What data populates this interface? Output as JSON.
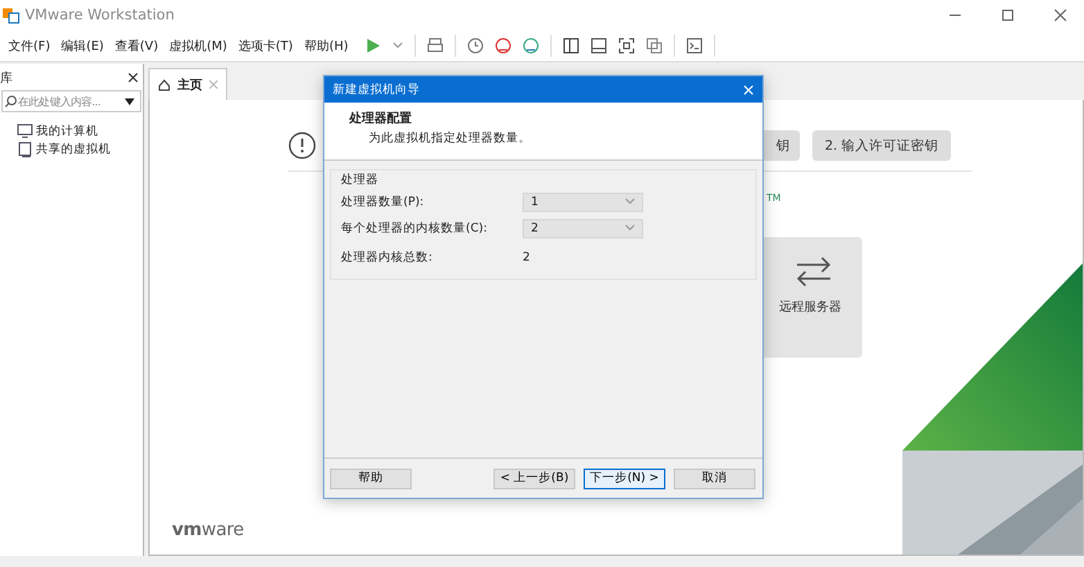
{
  "window": {
    "title": "VMware Workstation"
  },
  "menu": [
    {
      "label": "文件(F)"
    },
    {
      "label": "编辑(E)"
    },
    {
      "label": "查看(V)"
    },
    {
      "label": "虚拟机(M)"
    },
    {
      "label": "选项卡(T)"
    },
    {
      "label": "帮助(H)"
    }
  ],
  "library": {
    "title": "库",
    "search": {
      "placeholder": "在此处键入内容..."
    },
    "tree": [
      {
        "label": "我的计算机",
        "kind": "computer"
      },
      {
        "label": "共享的虚拟机",
        "kind": "shared"
      }
    ]
  },
  "tabs": [
    {
      "label": "主页",
      "selected": true
    }
  ],
  "home": {
    "license_buttons": [
      "钥",
      "2. 输入许可证密钥"
    ],
    "trademark": "TM",
    "remote_card": "远程服务器",
    "logo": "**vm**ware"
  },
  "dialog": {
    "title": "新建虚拟机向导",
    "heading": "处理器配置",
    "subtitle": "为此虚拟机指定处理器数量。",
    "group": "处理器",
    "fields": [
      {
        "label": "处理器数量(P):",
        "kind": "select",
        "value": "1"
      },
      {
        "label": "每个处理器的内核数量(C):",
        "kind": "select",
        "value": "2"
      },
      {
        "label": "处理器内核总数:",
        "kind": "text",
        "value": "2"
      }
    ],
    "buttons": [
      {
        "label": "帮助",
        "default": false
      },
      {
        "label": "< 上一步(B)",
        "default": false
      },
      {
        "label": "下一步(N) >",
        "default": true
      },
      {
        "label": "取消",
        "default": false
      }
    ]
  }
}
